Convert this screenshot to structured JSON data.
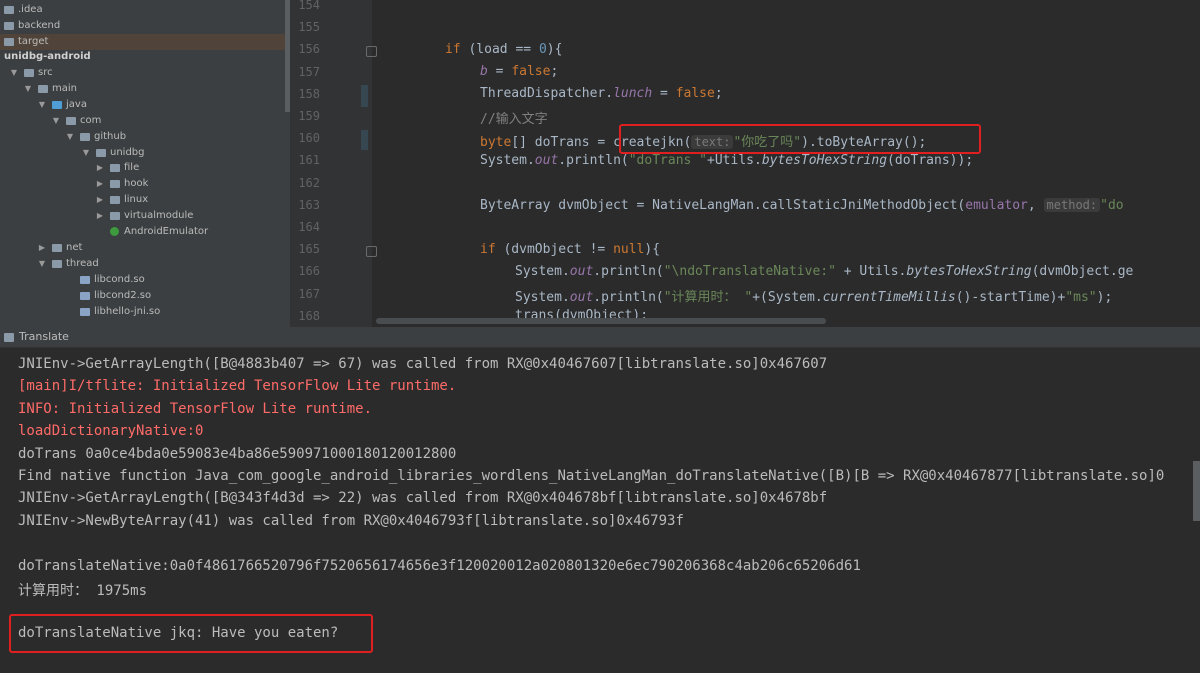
{
  "tree": {
    "items": [
      {
        "label": ".idea",
        "kind": "folder"
      },
      {
        "label": "backend",
        "kind": "folder"
      },
      {
        "label": "target",
        "kind": "folder"
      },
      {
        "label": "unidbg-android",
        "kind": "module"
      },
      {
        "label": "src",
        "kind": "folder"
      },
      {
        "label": "main",
        "kind": "folder"
      },
      {
        "label": "java",
        "kind": "sourceroot"
      },
      {
        "label": "com",
        "kind": "package"
      },
      {
        "label": "github",
        "kind": "package"
      },
      {
        "label": "unidbg",
        "kind": "package"
      },
      {
        "label": "file",
        "kind": "package"
      },
      {
        "label": "hook",
        "kind": "package"
      },
      {
        "label": "linux",
        "kind": "package"
      },
      {
        "label": "virtualmodule",
        "kind": "package"
      },
      {
        "label": "AndroidEmulator",
        "kind": "class"
      },
      {
        "label": "net",
        "kind": "folder"
      },
      {
        "label": "thread",
        "kind": "folder"
      },
      {
        "label": "libcond.so",
        "kind": "so"
      },
      {
        "label": "libcond2.so",
        "kind": "so"
      },
      {
        "label": "libhello-jni.so",
        "kind": "so"
      }
    ]
  },
  "editor": {
    "line_numbers": [
      "154",
      "155",
      "156",
      "157",
      "158",
      "159",
      "160",
      "161",
      "162",
      "163",
      "164",
      "165",
      "166",
      "167",
      "168"
    ],
    "lines": {
      "l156": {
        "kw": "if",
        "rest": " (load == ",
        "num": "0",
        "end": "){"
      },
      "l157": {
        "field": "b",
        "eq": " = ",
        "kw": "false",
        "end": ";"
      },
      "l158": {
        "cls": "ThreadDispatcher.",
        "field": "lunch",
        "eq": " = ",
        "kw": "false",
        "end": ";"
      },
      "l159": {
        "comment": "//输入文字"
      },
      "l160": {
        "kw": "byte",
        "mid": "[] doTrans = ",
        "call": "createjkn(",
        "hint": "text:",
        "str": "\"你吃了吗\"",
        "end": ").toByteArray();"
      },
      "l161": {
        "a": "System.",
        "field": "out",
        "b": ".println(",
        "str": "\"doTrans \"",
        "c": "+Utils.",
        "ital": "bytesToHexString",
        "d": "(doTrans));"
      },
      "l163": {
        "a": "ByteArray dvmObject = NativeLangMan.callStaticJniMethodObject(",
        "field": "emulator",
        "b": ", ",
        "hint": "method:",
        "str": "\"do"
      },
      "l165": {
        "kw": "if",
        "rest": " (dvmObject != ",
        "kw2": "null",
        "end": "){"
      },
      "l166": {
        "a": "System.",
        "field": "out",
        "b": ".println(",
        "str": "\"\\ndoTranslateNative:\"",
        "c": " + Utils.",
        "ital": "bytesToHexString",
        "d": "(dvmObject.ge"
      },
      "l167": {
        "a": "System.",
        "field": "out",
        "b": ".println(",
        "str": "\"计算用时： \"",
        "c": "+(System.",
        "ital": "currentTimeMillis",
        "d": "()-startTime)+",
        "str2": "\"ms\"",
        "e": ");"
      },
      "l168": {
        "a": "trans(dvmObject);"
      }
    }
  },
  "run": {
    "tab_label": "Translate"
  },
  "console": {
    "lines": [
      {
        "text": "JNIEnv->GetArrayLength([B@4883b407 => 67) was called from RX@0x40467607[libtranslate.so]0x467607",
        "level": "normal"
      },
      {
        "text": "[main]I/tflite: Initialized TensorFlow Lite runtime.",
        "level": "error"
      },
      {
        "text": "INFO: Initialized TensorFlow Lite runtime.",
        "level": "error"
      },
      {
        "text": "loadDictionaryNative:0",
        "level": "error"
      },
      {
        "text": "doTrans 0a0ce4bda0e59083e4ba86e590971000180120012800",
        "level": "normal"
      },
      {
        "text": "Find native function Java_com_google_android_libraries_wordlens_NativeLangMan_doTranslateNative([B)[B => RX@0x40467877[libtranslate.so]0",
        "level": "normal"
      },
      {
        "text": "JNIEnv->GetArrayLength([B@343f4d3d => 22) was called from RX@0x404678bf[libtranslate.so]0x4678bf",
        "level": "normal"
      },
      {
        "text": "JNIEnv->NewByteArray(41) was called from RX@0x4046793f[libtranslate.so]0x46793f",
        "level": "normal"
      },
      {
        "text": "",
        "level": "normal"
      },
      {
        "text": "doTranslateNative:0a0f4861766520796f7520656174656e3f120020012a020801320e6ec790206368c4ab206c65206d61",
        "level": "normal"
      },
      {
        "text": "计算用时： 1975ms",
        "level": "normal"
      },
      {
        "text": "",
        "level": "normal"
      },
      {
        "text": "doTranslateNative jkq: Have you eaten?",
        "level": "normal"
      }
    ]
  }
}
